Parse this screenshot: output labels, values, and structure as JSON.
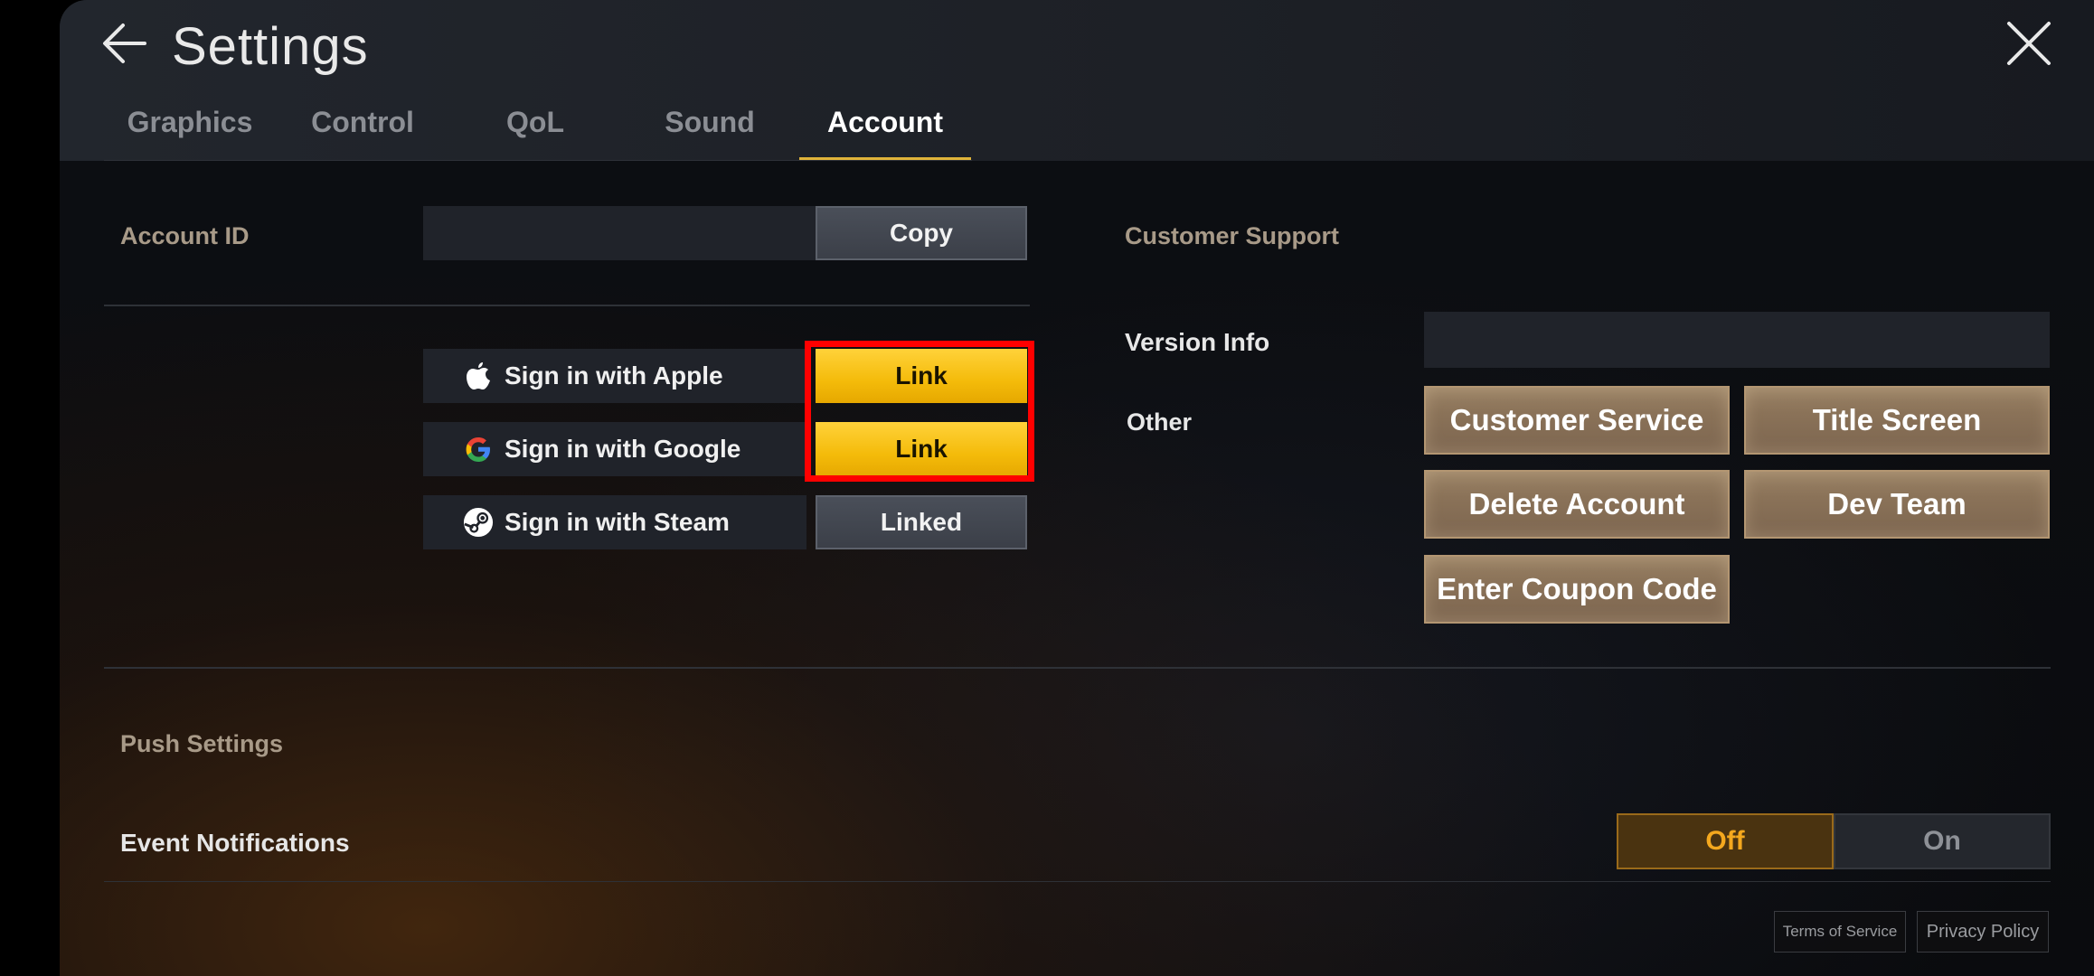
{
  "header": {
    "title": "Settings"
  },
  "tabs": [
    {
      "label": "Graphics",
      "active": false
    },
    {
      "label": "Control",
      "active": false
    },
    {
      "label": "QoL",
      "active": false
    },
    {
      "label": "Sound",
      "active": false
    },
    {
      "label": "Account",
      "active": true
    }
  ],
  "account": {
    "id_label": "Account ID",
    "id_value": "",
    "copy_label": "Copy",
    "signins": [
      {
        "label": "Sign in with Apple",
        "icon": "apple-icon",
        "button": "Link",
        "state": "link"
      },
      {
        "label": "Sign in with Google",
        "icon": "google-icon",
        "button": "Link",
        "state": "link"
      },
      {
        "label": "Sign in with Steam",
        "icon": "steam-icon",
        "button": "Linked",
        "state": "linked"
      }
    ]
  },
  "support": {
    "title": "Customer Support",
    "version_label": "Version Info",
    "version_value": "",
    "other_label": "Other",
    "buttons": {
      "customer_service": "Customer Service",
      "title_screen": "Title Screen",
      "delete_account": "Delete Account",
      "dev_team": "Dev Team",
      "coupon": "Enter Coupon Code"
    }
  },
  "push": {
    "title": "Push Settings",
    "event_label": "Event Notifications",
    "off_label": "Off",
    "on_label": "On",
    "selected": "Off"
  },
  "footer": {
    "terms": "Terms of Service",
    "privacy": "Privacy Policy"
  },
  "colors": {
    "accent_yellow": "#f4bb0a",
    "highlight_red": "#ff0000",
    "toggle_orange": "#f4a81e",
    "tab_underline": "#e0b43a"
  }
}
